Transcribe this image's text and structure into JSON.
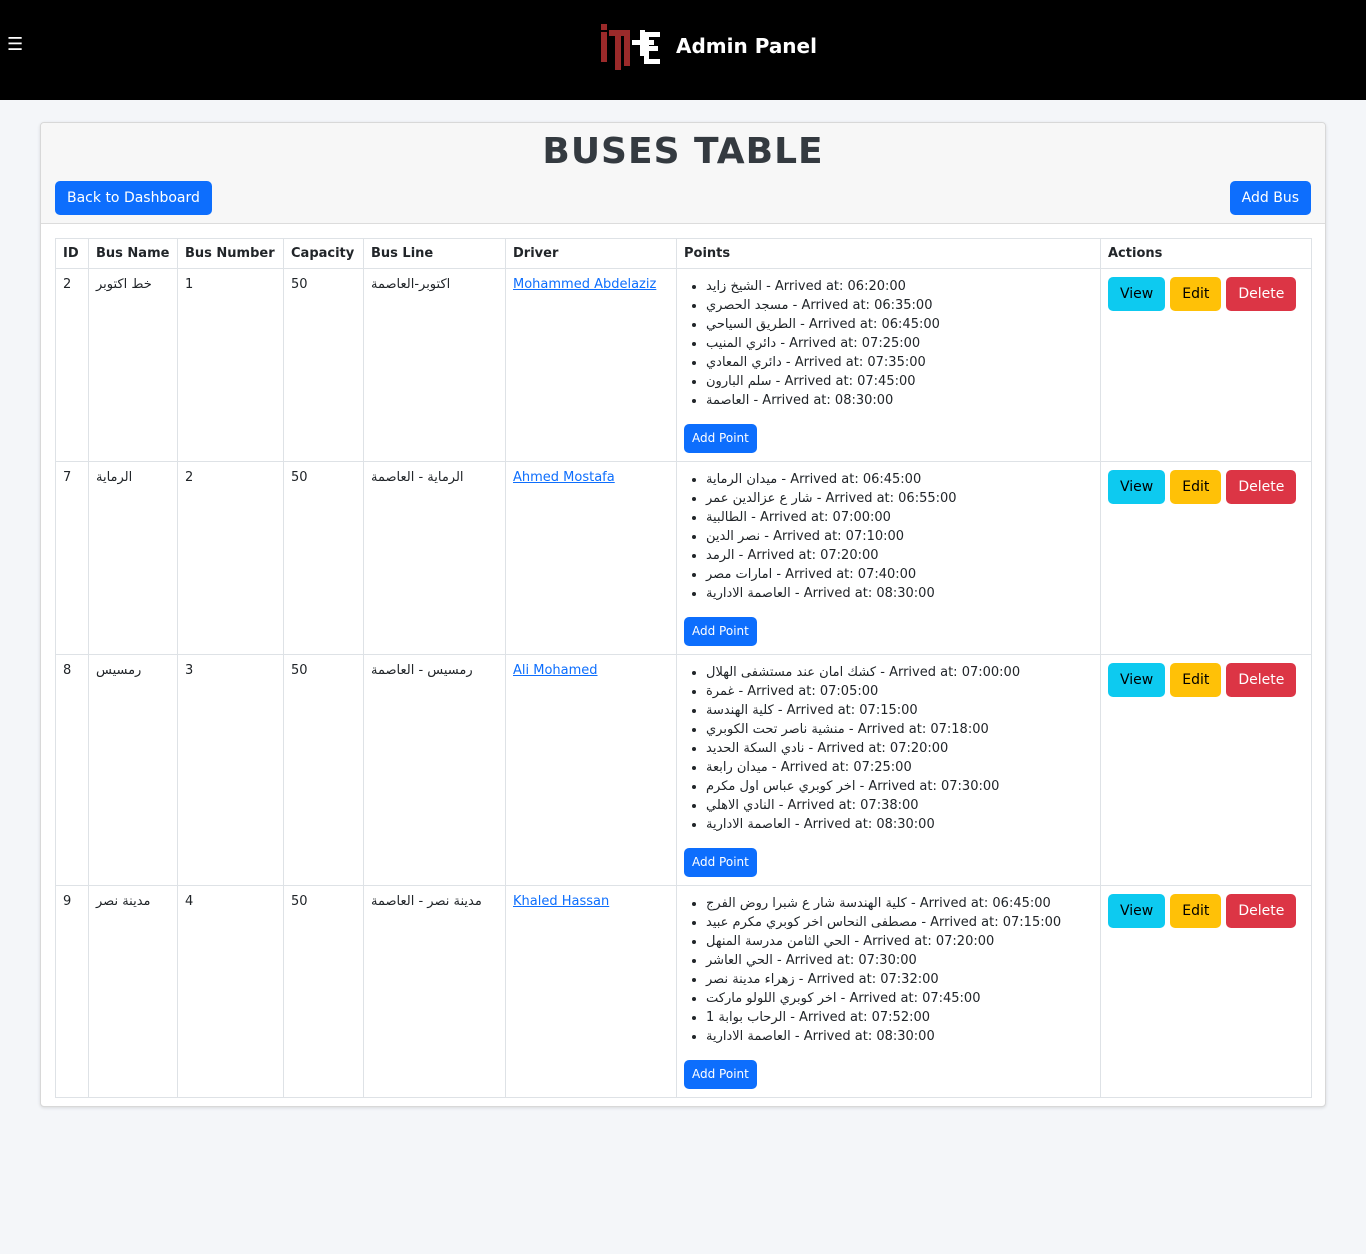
{
  "header": {
    "title": "Admin Panel",
    "menu_icon": "☰",
    "logo_text": "ITI E"
  },
  "page": {
    "title": "BUSES TABLE",
    "back_label": "Back to Dashboard",
    "add_bus_label": "Add Bus"
  },
  "table": {
    "columns": [
      "ID",
      "Bus Name",
      "Bus Number",
      "Capacity",
      "Bus Line",
      "Driver",
      "Points",
      "Actions"
    ],
    "action_labels": {
      "view": "View",
      "edit": "Edit",
      "delete": "Delete",
      "add_point": "Add Point"
    },
    "rows": [
      {
        "id": "2",
        "name": "خط اكتوبر",
        "number": "1",
        "capacity": "50",
        "line": "اكتوبر-العاصمة",
        "driver": "Mohammed Abdelaziz",
        "points": [
          "الشيخ زايد - Arrived at: 06:20:00",
          "مسجد الحصري - Arrived at: 06:35:00",
          "الطريق السياحي - Arrived at: 06:45:00",
          "دائري المنيب - Arrived at: 07:25:00",
          "دائري المعادي - Arrived at: 07:35:00",
          "سلم البارون - Arrived at: 07:45:00",
          "العاصمة - Arrived at: 08:30:00"
        ]
      },
      {
        "id": "7",
        "name": "الرماية",
        "number": "2",
        "capacity": "50",
        "line": "الرماية - العاصمة",
        "driver": "Ahmed Mostafa",
        "points": [
          "ميدان الرماية - Arrived at: 06:45:00",
          "شار ع عزالدين عمر - Arrived at: 06:55:00",
          "الطالبية - Arrived at: 07:00:00",
          "نصر الدين - Arrived at: 07:10:00",
          "الرمد - Arrived at: 07:20:00",
          "امارات مصر - Arrived at: 07:40:00",
          "العاصمة الادارية - Arrived at: 08:30:00"
        ]
      },
      {
        "id": "8",
        "name": "رمسيس",
        "number": "3",
        "capacity": "50",
        "line": "رمسيس - العاصمة",
        "driver": "Ali Mohamed",
        "points": [
          "كشك امان عند مستشفى الهلال - Arrived at: 07:00:00",
          "غمرة - Arrived at: 07:05:00",
          "كلية الهندسة - Arrived at: 07:15:00",
          "منشية ناصر تحت الكوبري - Arrived at: 07:18:00",
          "نادي السكة الحديد - Arrived at: 07:20:00",
          "ميدان رابعة - Arrived at: 07:25:00",
          "اخر كوبري عباس اول مكرم - Arrived at: 07:30:00",
          "النادي الاهلي - Arrived at: 07:38:00",
          "العاصمة الادارية - Arrived at: 08:30:00"
        ]
      },
      {
        "id": "9",
        "name": "مدينة نصر",
        "number": "4",
        "capacity": "50",
        "line": "مدينة نصر - العاصمة",
        "driver": "Khaled Hassan",
        "points": [
          "كلية الهندسة شار ع شبرا روض الفرج - Arrived at: 06:45:00",
          "مصطفى النحاس اخر كوبري مكرم عبيد - Arrived at: 07:15:00",
          "الحي الثامن مدرسة المنهل - Arrived at: 07:20:00",
          "الحي العاشر - Arrived at: 07:30:00",
          "زهراء مدينة نصر - Arrived at: 07:32:00",
          "اخر كوبري اللولو ماركت - Arrived at: 07:45:00",
          "الرحاب بوابة 1 - Arrived at: 07:52:00",
          "العاصمة الادارية - Arrived at: 08:30:00"
        ]
      }
    ]
  },
  "colors": {
    "primary": "#0d6efd",
    "info": "#0dcaf0",
    "warning": "#ffc107",
    "danger": "#dc3545",
    "header_bg": "#000000",
    "logo_red": "#9b2a2a"
  }
}
